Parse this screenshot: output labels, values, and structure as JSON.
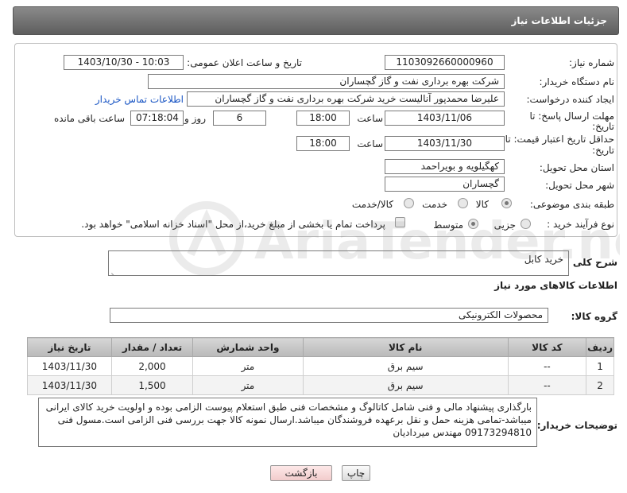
{
  "header": {
    "title": "جزئیات اطلاعات نیاز"
  },
  "fields": {
    "need_number_label": "شماره نیاز:",
    "need_number": "1103092660000960",
    "announce_label": "تاریخ و ساعت اعلان عمومی:",
    "announce_value": "1403/10/30 - 10:03",
    "buyer_org_label": "نام دستگاه خریدار:",
    "buyer_org": "شرکت بهره برداری نفت و گاز گچساران",
    "requester_label": "ایجاد کننده درخواست:",
    "requester": "علیرضا محمدپور آنالیست خرید شرکت بهره برداری نفت و گاز گچساران",
    "contact_link": "اطلاعات تماس خریدار",
    "deadline_label_1": "مهلت ارسال پاسخ: تا",
    "deadline_label_2": "تاریخ:",
    "deadline_date": "1403/11/06",
    "time_label": "ساعت",
    "deadline_time": "18:00",
    "days_value": "6",
    "days_label": "روز و",
    "remaining_value": "07:18:04",
    "remaining_label": "ساعت باقی مانده",
    "validity_label_1": "حداقل تاریخ اعتبار قیمت: تا",
    "validity_label_2": "تاریخ:",
    "validity_date": "1403/11/30",
    "validity_time": "18:00",
    "province_label": "استان محل تحویل:",
    "province": "کهگیلویه و بویراحمد",
    "city_label": "شهر محل تحویل:",
    "city": "گچساران",
    "category_label": "طبقه بندی موضوعی:",
    "category_options": [
      "کالا",
      "خدمت",
      "کالا/خدمت"
    ],
    "process_label": "نوع فرآیند خرید :",
    "process_options": [
      "جزیی",
      "متوسط"
    ],
    "payment_note": "پرداخت تمام یا بخشی از مبلغ خرید،از محل \"اسناد خزانه اسلامی\" خواهد بود."
  },
  "description": {
    "label": "شرح کلی نیاز:",
    "value": "خرید کابل"
  },
  "goods_section": {
    "title": "اطلاعات کالاهای مورد نیاز",
    "group_label": "گروه کالا:",
    "group_value": "محصولات الکترونیکی"
  },
  "table": {
    "headers": [
      "ردیف",
      "کد کالا",
      "نام کالا",
      "واحد شمارش",
      "تعداد / مقدار",
      "تاریخ نیاز"
    ],
    "rows": [
      [
        "1",
        "--",
        "سیم برق",
        "متر",
        "2,000",
        "1403/11/30"
      ],
      [
        "2",
        "--",
        "سیم برق",
        "متر",
        "1,500",
        "1403/11/30"
      ]
    ]
  },
  "buyer_notes": {
    "label": "توضیحات خریدار:",
    "value": "بارگذاری پیشنهاد مالی و فنی شامل کاتالوگ و مشخصات فنی طبق استعلام پیوست الزامی بوده و اولویت خرید کالای ایرانی میباشد-تمامی هزینه حمل و نقل برعهده فروشندگان میباشد.ارسال نمونه کالا جهت بررسی فنی الزامی است.مسول فنی 09173294810 مهندس میردادیان"
  },
  "buttons": {
    "print": "چاپ",
    "back": "بازگشت"
  },
  "watermark": {
    "text": "AriaTender.net"
  },
  "colors": {
    "link": "#1a56c4",
    "header_bg": "#6e6e6e",
    "back_button_bg": "#f6d6d6"
  }
}
